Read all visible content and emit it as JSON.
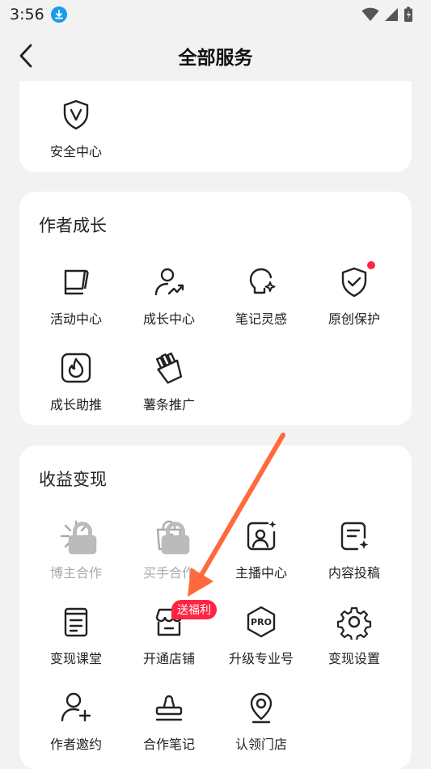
{
  "status_bar": {
    "time": "3:56"
  },
  "navbar": {
    "title": "全部服务"
  },
  "security": {
    "items": [
      {
        "label": "安全中心",
        "icon": "shield-v-icon"
      }
    ]
  },
  "growth": {
    "title": "作者成长",
    "items": [
      {
        "label": "活动中心",
        "icon": "flag-icon"
      },
      {
        "label": "成长中心",
        "icon": "user-growth-icon"
      },
      {
        "label": "笔记灵感",
        "icon": "bulb-icon"
      },
      {
        "label": "原创保护",
        "icon": "shield-check-icon",
        "has_red_dot": true
      },
      {
        "label": "成长助推",
        "icon": "flame-icon"
      },
      {
        "label": "薯条推广",
        "icon": "fries-icon"
      }
    ]
  },
  "monetize": {
    "title": "收益变现",
    "items": [
      {
        "label": "博主合作",
        "icon": "sparkle-icon",
        "locked": true
      },
      {
        "label": "买手合作",
        "icon": "shopping-bag-icon",
        "locked": true
      },
      {
        "label": "主播中心",
        "icon": "live-host-icon"
      },
      {
        "label": "内容投稿",
        "icon": "document-sparkle-icon"
      },
      {
        "label": "变现课堂",
        "icon": "notebook-icon"
      },
      {
        "label": "开通店铺",
        "icon": "store-icon",
        "badge": "送福利"
      },
      {
        "label": "升级专业号",
        "icon": "pro-badge-icon"
      },
      {
        "label": "变现设置",
        "icon": "gear-icon"
      },
      {
        "label": "作者邀约",
        "icon": "user-add-icon"
      },
      {
        "label": "合作笔记",
        "icon": "stamp-icon"
      },
      {
        "label": "认领门店",
        "icon": "location-pin-icon"
      }
    ]
  },
  "colors": {
    "accent_red": "#ff2442",
    "arrow": "#ff6a3d",
    "download_blue": "#1a9bf0"
  }
}
